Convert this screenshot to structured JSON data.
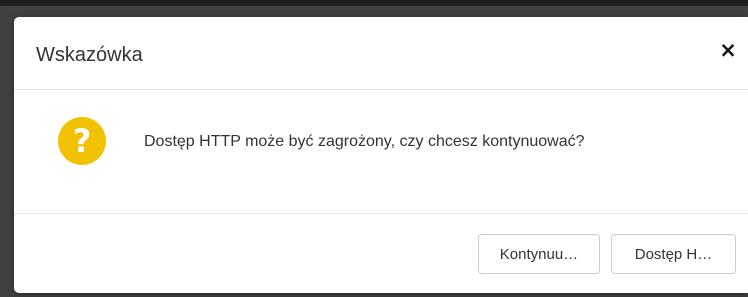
{
  "dialog": {
    "title": "Wskazówka",
    "close_label": "×",
    "icon": "question-icon",
    "icon_glyph": "?",
    "icon_color": "#f2c200",
    "message": "Dostęp HTTP może być zagrożony, czy chcesz kontynuować?",
    "buttons": {
      "continue_label": "Kontynuu…",
      "access_label": "Dostęp H…"
    }
  }
}
